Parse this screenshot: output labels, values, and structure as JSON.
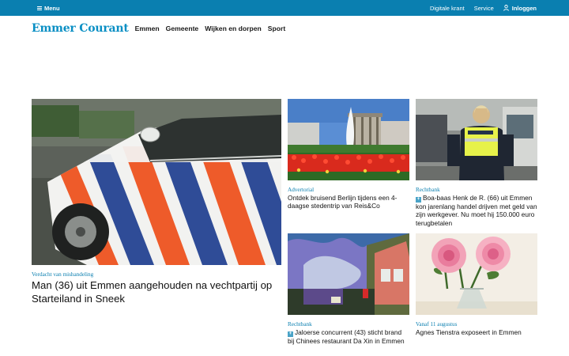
{
  "topbar": {
    "menu_label": "Menu",
    "links": [
      "Digitale krant",
      "Service"
    ],
    "login_label": "Inloggen"
  },
  "masthead": {
    "logo": "Emmer Courant",
    "nav": [
      "Emmen",
      "Gemeente",
      "Wijken en dorpen",
      "Sport"
    ]
  },
  "articles": {
    "main": {
      "kicker": "Verdacht van mishandeling",
      "title": "Man (36) uit Emmen aangehouden na vechtpartij op Starteiland in Sneek",
      "image": "police-car-photo"
    },
    "berlin": {
      "kicker": "Advertorial",
      "title": "Ontdek bruisend Berlijn tijdens een 4-daagse stedentrip van Reis&Co",
      "image": "brandenburg-gate-photo"
    },
    "boa": {
      "kicker": "Rechtbank",
      "title": "Boa-baas Henk de R. (66) uit Emmen kon jarenlang handel drijven met geld van zijn werkgever. Nu moet hij 150.000 euro terugbetalen",
      "image": "enforcement-officer-photo",
      "premium": true
    },
    "fire": {
      "kicker": "Rechtbank",
      "title": "Jaloerse concurrent (43) sticht brand bij Chinees restaurant Da Xin in Emmen",
      "image": "fire-scene-photo",
      "premium": true
    },
    "roses": {
      "kicker": "Vanaf 11 augustus",
      "title": "Agnes Tienstra exposeert in Emmen",
      "image": "rose-painting"
    }
  },
  "colors": {
    "brand": "#0a7fb0",
    "logo": "#0a8fc4"
  }
}
